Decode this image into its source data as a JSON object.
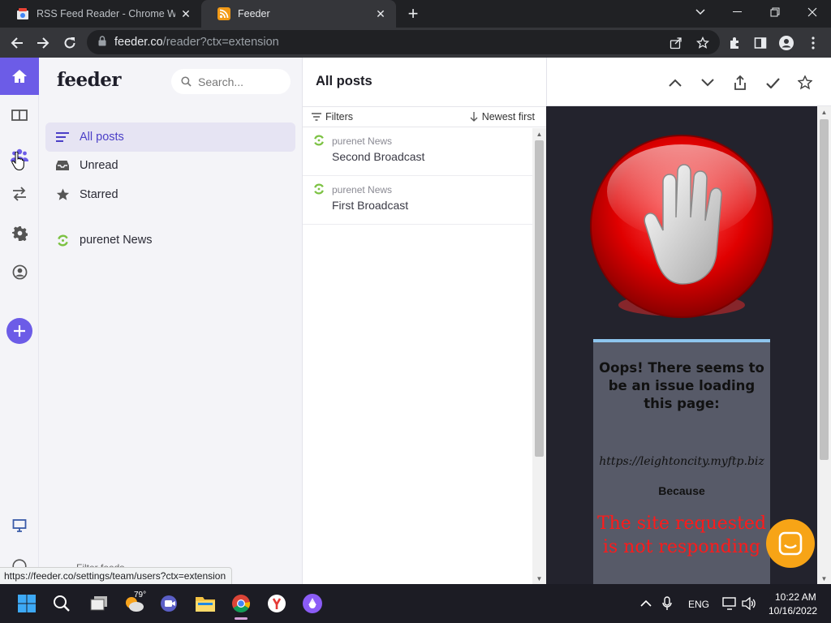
{
  "browser": {
    "tabs": [
      {
        "title": "RSS Feed Reader - Chrome Web",
        "active": false
      },
      {
        "title": "Feeder",
        "active": true
      }
    ],
    "address": {
      "host": "feeder.co",
      "path": "/reader?ctx=extension"
    },
    "status_url": "https://feeder.co/settings/team/users?ctx=extension"
  },
  "app": {
    "logo": "feeder",
    "search_placeholder": "Search...",
    "nav": [
      {
        "label": "All posts",
        "icon": "list-icon",
        "active": true
      },
      {
        "label": "Unread",
        "icon": "inbox-icon",
        "active": false
      },
      {
        "label": "Starred",
        "icon": "star-icon",
        "active": false
      }
    ],
    "feeds": [
      {
        "label": "purenet News",
        "icon": "feed-refresh-icon"
      }
    ],
    "sidebar_bottom": "Filter feeds",
    "accent_color": "#6c5ce7"
  },
  "posts_column": {
    "title": "All posts",
    "filters_label": "Filters",
    "sort_label": "Newest first",
    "posts": [
      {
        "source": "purenet News",
        "title": "Second Broadcast"
      },
      {
        "source": "purenet News",
        "title": "First Broadcast"
      }
    ]
  },
  "reader": {
    "toolbar": [
      "chevron-up-icon",
      "chevron-down-icon",
      "share-icon",
      "check-icon",
      "star-outline-icon"
    ],
    "error": {
      "heading": "Oops! There seems to be an issue loading this page:",
      "url": "https://leightoncity.myftp.biz",
      "because": "Because",
      "reason_line1": "The site requested",
      "reason_line2": "is not responding"
    }
  },
  "taskbar": {
    "weather_temp": "79°",
    "language": "ENG",
    "time": "10:22 AM",
    "date": "10/16/2022"
  }
}
